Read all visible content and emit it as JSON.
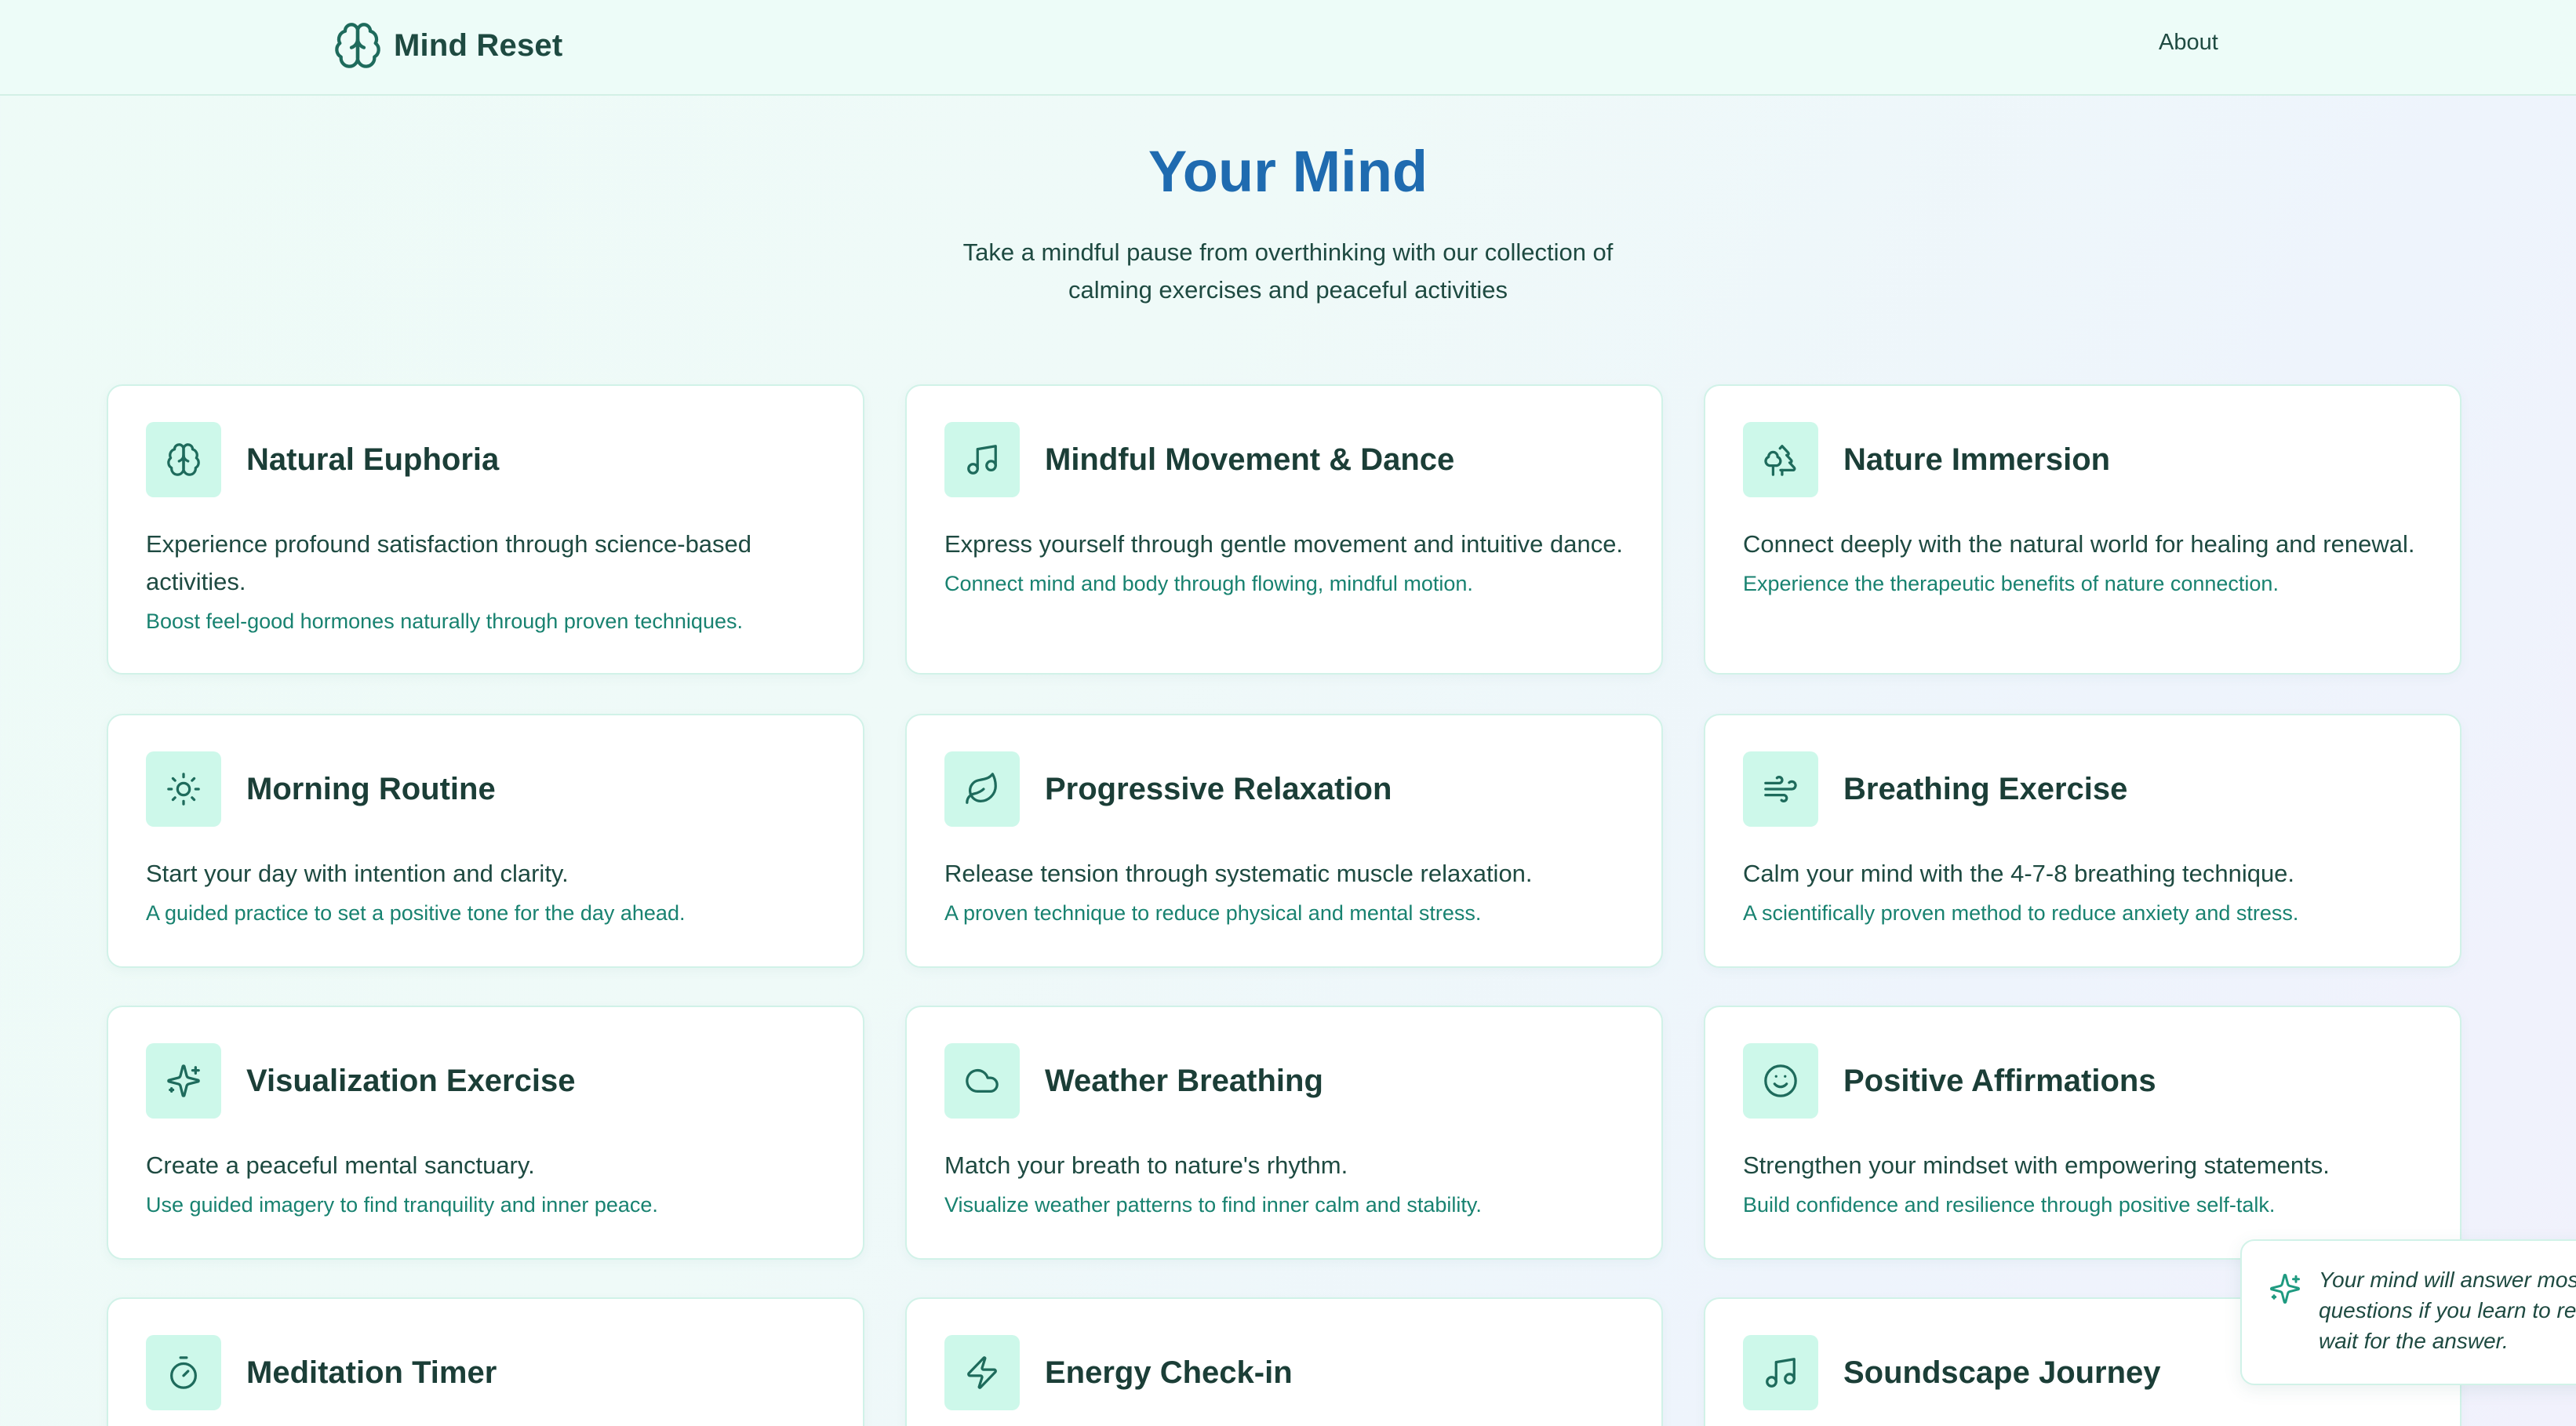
{
  "header": {
    "brand_name": "Mind Reset",
    "brand_icon": "brain-icon",
    "nav": {
      "about_label": "About"
    }
  },
  "hero": {
    "title": "Your Mind",
    "subtitle": "Take a mindful pause from overthinking with our collection of calming exercises and peaceful activities"
  },
  "cards": [
    {
      "icon": "brain-icon",
      "title": "Natural Euphoria",
      "description": "Experience profound satisfaction through science-based activities.",
      "note": "Boost feel-good hormones naturally through proven techniques."
    },
    {
      "icon": "music-icon",
      "title": "Mindful Movement & Dance",
      "description": "Express yourself through gentle movement and intuitive dance.",
      "note": "Connect mind and body through flowing, mindful motion."
    },
    {
      "icon": "trees-icon",
      "title": "Nature Immersion",
      "description": "Connect deeply with the natural world for healing and renewal.",
      "note": "Experience the therapeutic benefits of nature connection."
    },
    {
      "icon": "sun-icon",
      "title": "Morning Routine",
      "description": "Start your day with intention and clarity.",
      "note": "A guided practice to set a positive tone for the day ahead."
    },
    {
      "icon": "leaf-icon",
      "title": "Progressive Relaxation",
      "description": "Release tension through systematic muscle relaxation.",
      "note": "A proven technique to reduce physical and mental stress."
    },
    {
      "icon": "wind-icon",
      "title": "Breathing Exercise",
      "description": "Calm your mind with the 4-7-8 breathing technique.",
      "note": "A scientifically proven method to reduce anxiety and stress."
    },
    {
      "icon": "sparkles-icon",
      "title": "Visualization Exercise",
      "description": "Create a peaceful mental sanctuary.",
      "note": "Use guided imagery to find tranquility and inner peace."
    },
    {
      "icon": "cloud-icon",
      "title": "Weather Breathing",
      "description": "Match your breath to nature's rhythm.",
      "note": "Visualize weather patterns to find inner calm and stability."
    },
    {
      "icon": "smile-icon",
      "title": "Positive Affirmations",
      "description": "Strengthen your mindset with empowering statements.",
      "note": "Build confidence and resilience through positive self-talk."
    },
    {
      "icon": "timer-icon",
      "title": "Meditation Timer",
      "description": "",
      "note": ""
    },
    {
      "icon": "zap-icon",
      "title": "Energy Check-in",
      "description": "",
      "note": ""
    },
    {
      "icon": "music-icon",
      "title": "Soundscape Journey",
      "description": "",
      "note": ""
    }
  ],
  "quote": {
    "icon": "sparkles-icon",
    "text": "Your mind will answer most questions if you learn to relax and wait for the answer."
  },
  "colors": {
    "accent_blue": "#1f6bb0",
    "icon_teal": "#1e6b5c",
    "icon_bg": "#cdf8ea",
    "note_green": "#188270",
    "card_border": "#d1f2e8"
  }
}
